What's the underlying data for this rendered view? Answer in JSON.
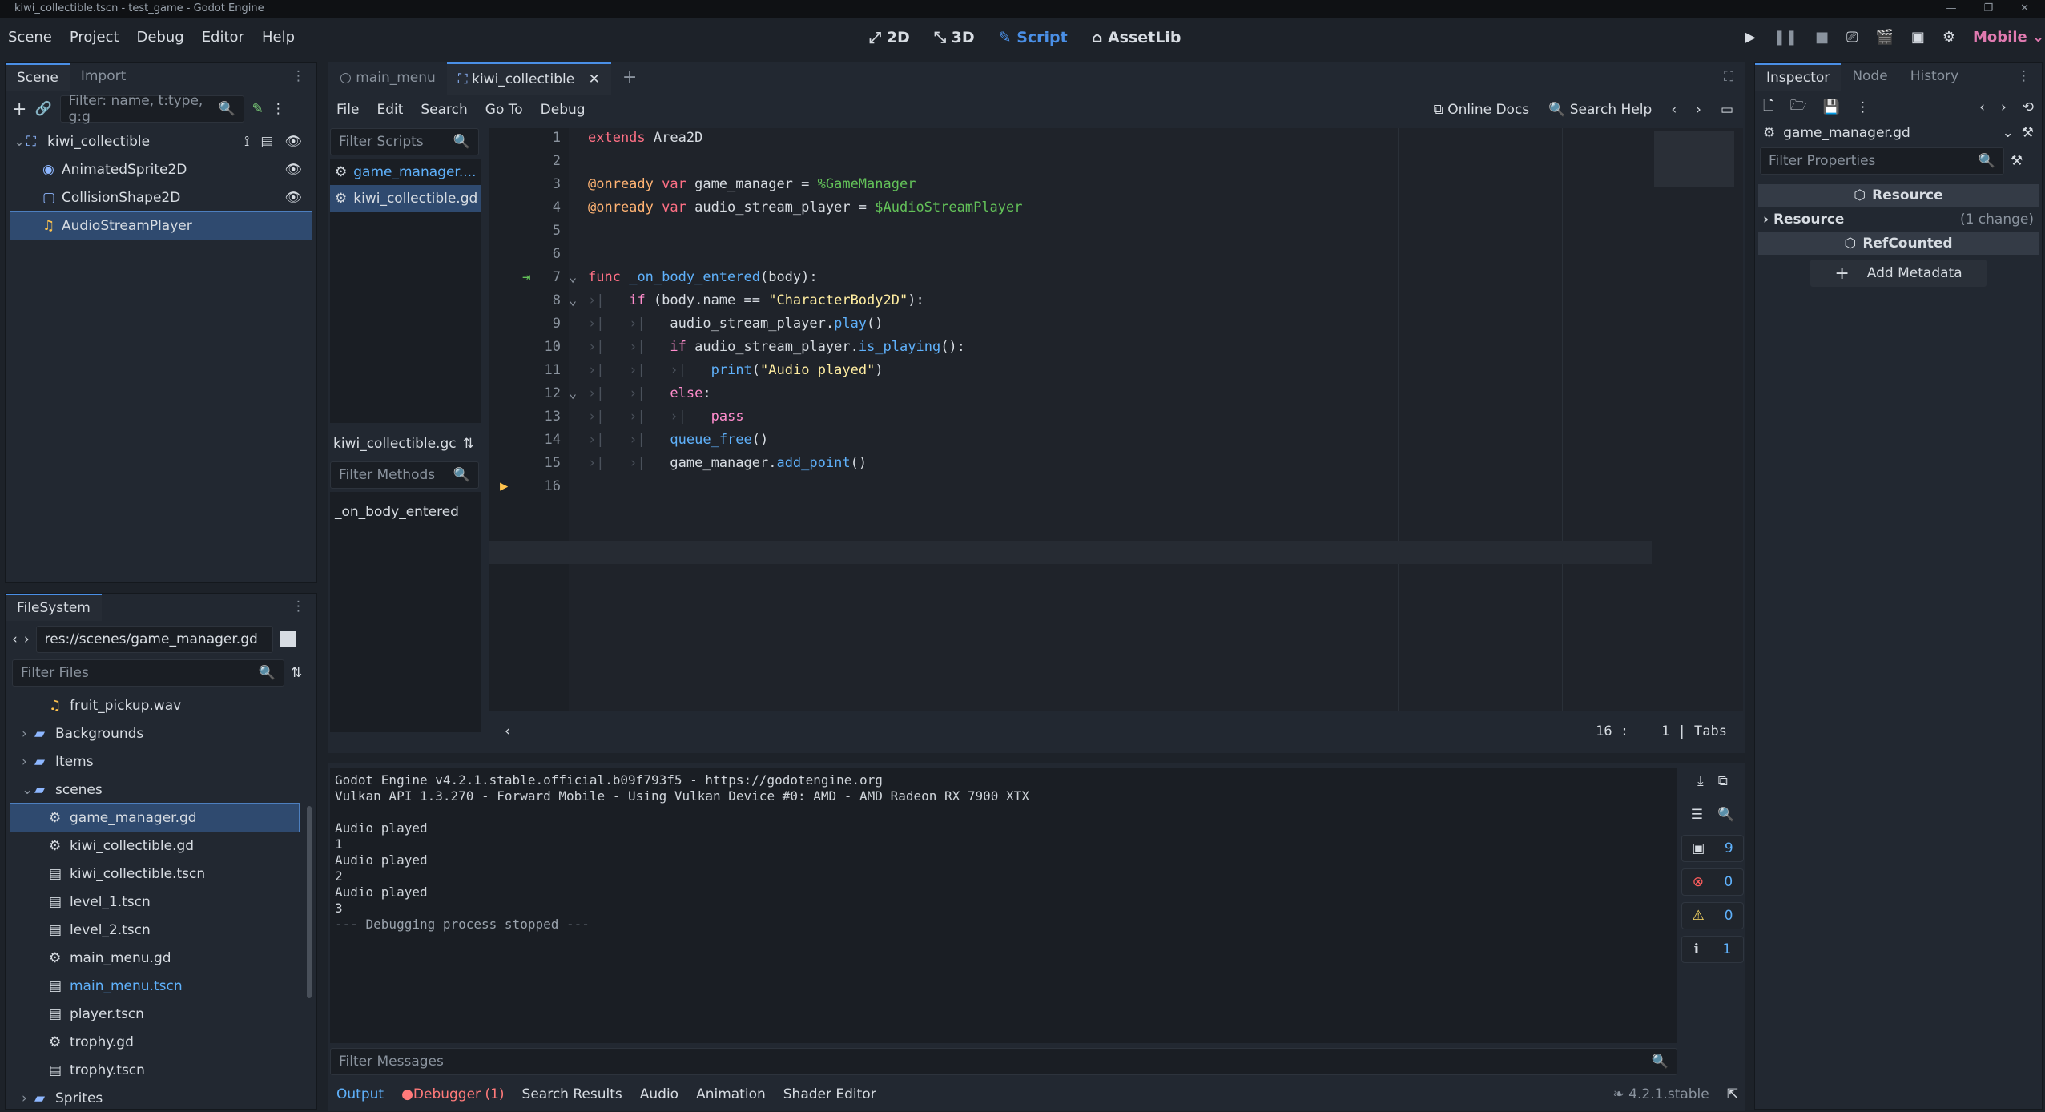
{
  "window": {
    "title": "kiwi_collectible.tscn - test_game - Godot Engine"
  },
  "menubar": {
    "menus": [
      "Scene",
      "Project",
      "Debug",
      "Editor",
      "Help"
    ],
    "workspaces": [
      {
        "label": "2D",
        "icon": "2d-icon"
      },
      {
        "label": "3D",
        "icon": "3d-icon"
      },
      {
        "label": "Script",
        "icon": "script-icon",
        "active": true
      },
      {
        "label": "AssetLib",
        "icon": "assetlib-icon"
      }
    ],
    "renderer": "Mobile"
  },
  "scene_dock": {
    "tabs": [
      "Scene",
      "Import"
    ],
    "filter_placeholder": "Filter: name, t:type, g:g",
    "nodes": [
      {
        "label": "kiwi_collectible",
        "icon": "area2d-icon"
      },
      {
        "label": "AnimatedSprite2D",
        "icon": "animated-sprite-icon"
      },
      {
        "label": "CollisionShape2D",
        "icon": "collision-shape-icon"
      },
      {
        "label": "AudioStreamPlayer",
        "icon": "audio-player-icon",
        "selected": true
      }
    ]
  },
  "filesystem": {
    "tab": "FileSystem",
    "path": "res://scenes/game_manager.gd",
    "filter_placeholder": "Filter Files",
    "items": [
      {
        "label": "fruit_pickup.wav",
        "type": "audio",
        "indent": 2
      },
      {
        "label": "Backgrounds",
        "type": "folder",
        "indent": 1
      },
      {
        "label": "Items",
        "type": "folder",
        "indent": 1
      },
      {
        "label": "scenes",
        "type": "folder-open",
        "indent": 1
      },
      {
        "label": "game_manager.gd",
        "type": "script",
        "indent": 2,
        "selected": true
      },
      {
        "label": "kiwi_collectible.gd",
        "type": "script",
        "indent": 2
      },
      {
        "label": "kiwi_collectible.tscn",
        "type": "scene",
        "indent": 2
      },
      {
        "label": "level_1.tscn",
        "type": "scene",
        "indent": 2
      },
      {
        "label": "level_2.tscn",
        "type": "scene",
        "indent": 2
      },
      {
        "label": "main_menu.gd",
        "type": "script",
        "indent": 2
      },
      {
        "label": "main_menu.tscn",
        "type": "scene",
        "indent": 2,
        "highlight": true
      },
      {
        "label": "player.tscn",
        "type": "scene",
        "indent": 2
      },
      {
        "label": "trophy.gd",
        "type": "script",
        "indent": 2
      },
      {
        "label": "trophy.tscn",
        "type": "scene",
        "indent": 2
      },
      {
        "label": "Sprites",
        "type": "folder",
        "indent": 1
      }
    ]
  },
  "editor_tabs": [
    {
      "label": "main_menu",
      "active": false
    },
    {
      "label": "kiwi_collectible",
      "active": true
    }
  ],
  "script_menu": [
    "File",
    "Edit",
    "Search",
    "Go To",
    "Debug"
  ],
  "script_links": {
    "online_docs": "Online Docs",
    "search_help": "Search Help"
  },
  "script_list": {
    "filter_placeholder": "Filter Scripts",
    "scripts": [
      {
        "label": "game_manager....",
        "highlight": true
      },
      {
        "label": "kiwi_collectible.gd",
        "selected": true
      }
    ],
    "current_label": "kiwi_collectible.gc",
    "methods_placeholder": "Filter Methods",
    "methods": [
      "_on_body_entered"
    ]
  },
  "code": {
    "status": {
      "line": "16",
      "col": "1",
      "indent": "Tabs"
    }
  },
  "output": {
    "lines": [
      "Godot Engine v4.2.1.stable.official.b09f793f5 - https://godotengine.org",
      "Vulkan API 1.3.270 - Forward Mobile - Using Vulkan Device #0: AMD - AMD Radeon RX 7900 XTX",
      "",
      "Audio played",
      "1",
      "Audio played",
      "2",
      "Audio played",
      "3",
      "--- Debugging process stopped ---"
    ],
    "counts": {
      "messages": "9",
      "errors": "0",
      "warnings": "0",
      "info": "1"
    },
    "filter_placeholder": "Filter Messages"
  },
  "bottom_tabs": [
    "Output",
    "Debugger (1)",
    "Search Results",
    "Audio",
    "Animation",
    "Shader Editor"
  ],
  "version": "4.2.1.stable",
  "inspector": {
    "tabs": [
      "Inspector",
      "Node",
      "History"
    ],
    "resource_name": "game_manager.gd",
    "filter_placeholder": "Filter Properties",
    "sections": {
      "resource_header": "Resource",
      "resource_row": "Resource",
      "resource_change": "(1 change)",
      "refcounted": "RefCounted",
      "add_metadata": "Add Metadata"
    }
  }
}
